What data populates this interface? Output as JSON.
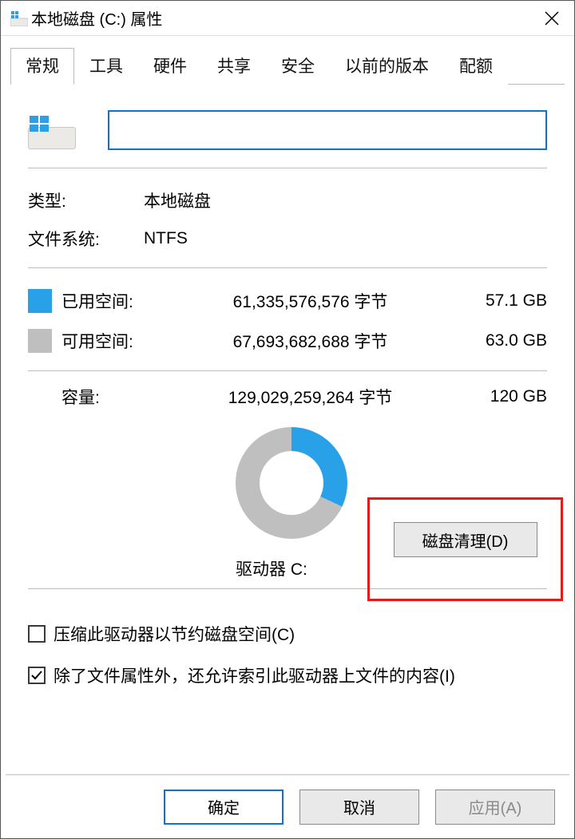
{
  "titlebar": {
    "title": "本地磁盘 (C:) 属性"
  },
  "tabs": {
    "items": [
      {
        "label": "常规",
        "active": true
      },
      {
        "label": "工具",
        "active": false
      },
      {
        "label": "硬件",
        "active": false
      },
      {
        "label": "共享",
        "active": false
      },
      {
        "label": "安全",
        "active": false
      },
      {
        "label": "以前的版本",
        "active": false
      },
      {
        "label": "配额",
        "active": false
      }
    ]
  },
  "general": {
    "name_value": "",
    "type_label": "类型:",
    "type_value": "本地磁盘",
    "fs_label": "文件系统:",
    "fs_value": "NTFS",
    "used": {
      "label": "已用空间:",
      "bytes": "61,335,576,576 字节",
      "gb": "57.1 GB",
      "color": "#29a1e9"
    },
    "free": {
      "label": "可用空间:",
      "bytes": "67,693,682,688 字节",
      "gb": "63.0 GB",
      "color": "#bfbfbf"
    },
    "capacity": {
      "label": "容量:",
      "bytes": "129,029,259,264 字节",
      "gb": "120 GB"
    },
    "drive_label": "驱动器 C:",
    "cleanup_button": "磁盘清理(D)",
    "check_compress": "压缩此驱动器以节约磁盘空间(C)",
    "check_index": "除了文件属性外，还允许索引此驱动器上文件的内容(I)"
  },
  "buttons": {
    "ok": "确定",
    "cancel": "取消",
    "apply": "应用(A)"
  }
}
